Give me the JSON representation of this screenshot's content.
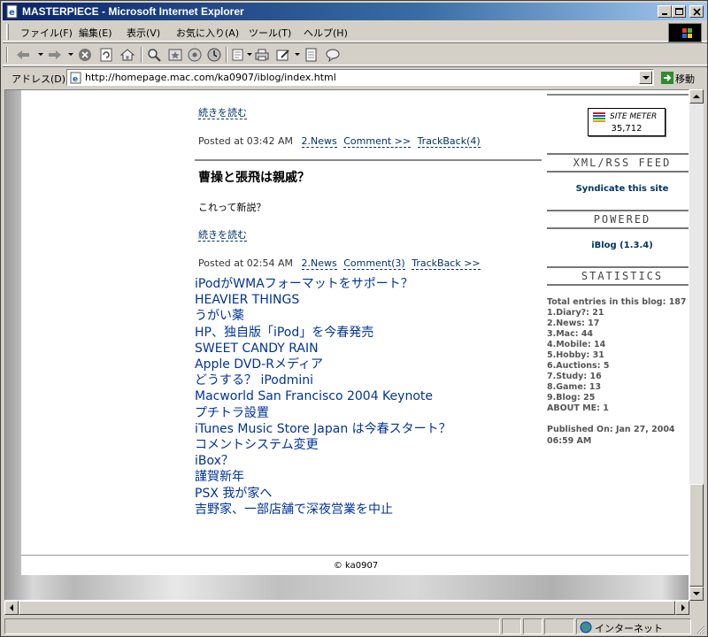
{
  "window": {
    "title": "MASTERPIECE - Microsoft Internet Explorer"
  },
  "menu": [
    "ファイル(F)",
    "編集(E)",
    "表示(V)",
    "お気に入り(A)",
    "ツール(T)",
    "ヘルプ(H)"
  ],
  "address": {
    "label": "アドレス(D)",
    "url": "http://homepage.mac.com/ka0907/iblog/index.html",
    "go_label": "移動"
  },
  "entries": [
    {
      "more": "続きを読む",
      "posted": "Posted at 03:42 AM",
      "category": "2.News",
      "comment": "Comment >>",
      "trackback": "TrackBack(4)"
    },
    {
      "title": "曹操と張飛は親戚？",
      "body": "これって新説？",
      "more": "続きを読む",
      "posted": "Posted at 02:54 AM",
      "category": "2.News",
      "comment": "Comment(3)",
      "trackback": "TrackBack >>"
    }
  ],
  "recent": [
    "iPodがWMAフォーマットをサポート？",
    "HEAVIER THINGS",
    "うがい薬",
    "HP、独自版「iPod」を今春発売",
    "SWEET CANDY RAIN",
    "Apple DVD-Rメディア",
    "どうする？ iPodmini",
    "Macworld San Francisco 2004 Keynote",
    "プチトラ設置",
    "iTunes Music Store Japan は今春スタート？",
    "コメントシステム変更",
    "iBox？",
    "謹賀新年",
    "PSX 我が家へ",
    "吉野家、一部店舗で深夜営業を中止"
  ],
  "sidebar": {
    "sitemeter_title": "SITE METER",
    "sitemeter_count": "35,712",
    "xml_heading": "XML/RSS FEED",
    "syndicate": "Syndicate this site",
    "powered_heading": "POWERED",
    "powered_by": "iBlog (1.3.4)",
    "stats_heading": "STATISTICS",
    "stats": [
      "Total entries in this blog: 187",
      "1.Diary?: 21",
      "2.News: 17",
      "3.Mac: 44",
      "4.Mobile: 14",
      "5.Hobby: 31",
      "6.Auctions: 5",
      "7.Study: 16",
      "8.Game: 13",
      "9.Blog: 25",
      "ABOUT ME: 1"
    ],
    "published_line1": "Published On: Jan 27, 2004",
    "published_line2": "06:59 AM"
  },
  "footer": "© ka0907",
  "status": {
    "zone": "インターネット"
  },
  "colors": {
    "titlebar": "#0a246a",
    "link": "#003399",
    "chrome": "#d4d0c8"
  }
}
